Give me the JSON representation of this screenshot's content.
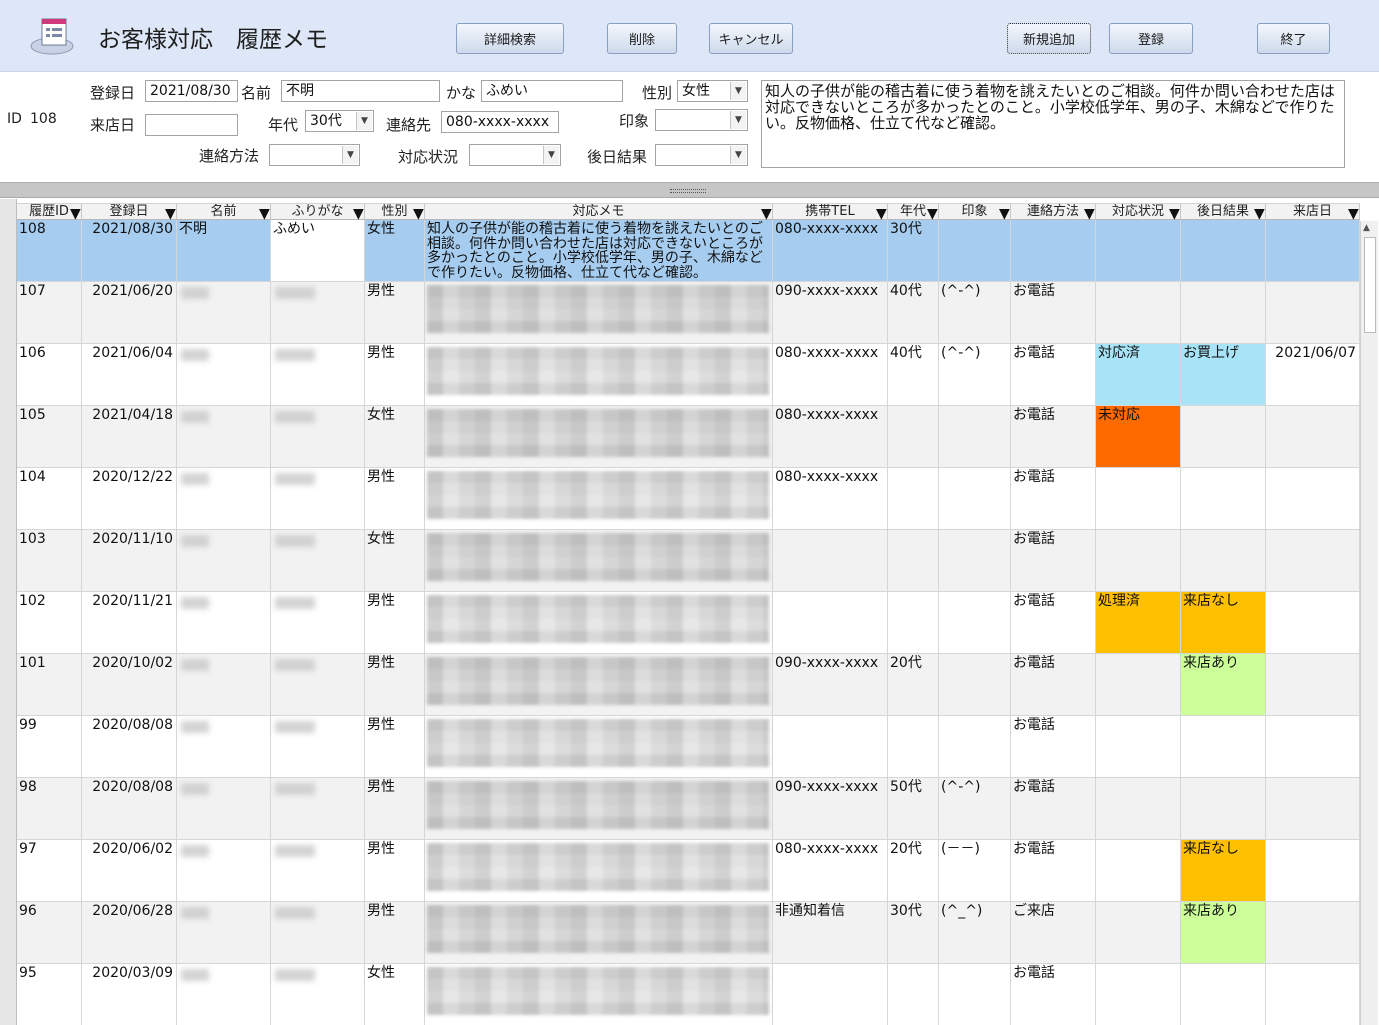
{
  "header": {
    "title": "お客様対応　履歴メモ",
    "buttons": {
      "detail_search": "詳細検索",
      "delete": "削除",
      "cancel": "キャンセル",
      "new_add": "新規追加",
      "register": "登録",
      "exit": "終了"
    }
  },
  "form": {
    "id_label": "ID",
    "id_value": "108",
    "reg_date_label": "登録日",
    "reg_date_value": "2021/08/30",
    "name_label": "名前",
    "name_value": "不明",
    "kana_label": "かな",
    "kana_value": "ふめい",
    "gender_label": "性別",
    "gender_value": "女性",
    "visit_date_label": "来店日",
    "visit_date_value": "",
    "age_label": "年代",
    "age_value": "30代",
    "contact_label": "連絡先",
    "contact_value": "080-xxxx-xxxx",
    "impression_label": "印象",
    "impression_value": "",
    "contact_method_label": "連絡方法",
    "contact_method_value": "",
    "status_label": "対応状況",
    "status_value": "",
    "result_label": "後日結果",
    "result_value": "",
    "memo": "知人の子供が能の稽古着に使う着物を誂えたいとのご相談。何件か問い合わせた店は対応できないところが多かったとのこと。小学校低学年、男の子、木綿などで作りたい。反物価格、仕立て代など確認。"
  },
  "columns": [
    "履歴ID",
    "登録日",
    "名前",
    "ふりがな",
    "性別",
    "対応メモ",
    "携帯TEL",
    "年代",
    "印象",
    "連絡方法",
    "対応状況",
    "後日結果",
    "来店日"
  ],
  "rows": [
    {
      "id": "108",
      "date": "2021/08/30",
      "name": "不明",
      "kana": "ふめい",
      "gender": "女性",
      "memo": "知人の子供が能の稽古着に使う着物を誂えたいとのご相談。何件か問い合わせた店は対応できないところが多かったとのこと。小学校低学年、男の子、木綿などで作りたい。反物価格、仕立て代など確認。",
      "tel": "080-xxxx-xxxx",
      "age": "30代",
      "impression": "",
      "method": "",
      "status": "",
      "result": "",
      "visit": ""
    },
    {
      "id": "107",
      "date": "2021/06/20",
      "name": "",
      "kana": "",
      "gender": "男性",
      "memo": "",
      "tel": "090-xxxx-xxxx",
      "age": "40代",
      "impression": "(^-^)",
      "method": "お電話",
      "status": "",
      "result": "",
      "visit": ""
    },
    {
      "id": "106",
      "date": "2021/06/04",
      "name": "",
      "kana": "",
      "gender": "男性",
      "memo": "",
      "tel": "080-xxxx-xxxx",
      "age": "40代",
      "impression": "(^-^)",
      "method": "お電話",
      "status": "対応済",
      "result": "お買上げ",
      "visit": "2021/06/07"
    },
    {
      "id": "105",
      "date": "2021/04/18",
      "name": "",
      "kana": "",
      "gender": "女性",
      "memo": "",
      "tel": "080-xxxx-xxxx",
      "age": "",
      "impression": "",
      "method": "お電話",
      "status": "未対応",
      "result": "",
      "visit": ""
    },
    {
      "id": "104",
      "date": "2020/12/22",
      "name": "",
      "kana": "",
      "gender": "男性",
      "memo": "",
      "tel": "080-xxxx-xxxx",
      "age": "",
      "impression": "",
      "method": "お電話",
      "status": "",
      "result": "",
      "visit": ""
    },
    {
      "id": "103",
      "date": "2020/11/10",
      "name": "",
      "kana": "",
      "gender": "女性",
      "memo": "",
      "tel": "",
      "age": "",
      "impression": "",
      "method": "お電話",
      "status": "",
      "result": "",
      "visit": ""
    },
    {
      "id": "102",
      "date": "2020/11/21",
      "name": "",
      "kana": "",
      "gender": "男性",
      "memo": "",
      "tel": "",
      "age": "",
      "impression": "",
      "method": "お電話",
      "status": "処理済",
      "result": "来店なし",
      "visit": ""
    },
    {
      "id": "101",
      "date": "2020/10/02",
      "name": "",
      "kana": "",
      "gender": "男性",
      "memo": "",
      "tel": "090-xxxx-xxxx",
      "age": "20代",
      "impression": "",
      "method": "お電話",
      "status": "",
      "result": "来店あり",
      "visit": ""
    },
    {
      "id": "99",
      "date": "2020/08/08",
      "name": "",
      "kana": "",
      "gender": "男性",
      "memo": "",
      "tel": "",
      "age": "",
      "impression": "",
      "method": "お電話",
      "status": "",
      "result": "",
      "visit": ""
    },
    {
      "id": "98",
      "date": "2020/08/08",
      "name": "",
      "kana": "",
      "gender": "男性",
      "memo": "",
      "tel": "090-xxxx-xxxx",
      "age": "50代",
      "impression": "(^-^)",
      "method": "お電話",
      "status": "",
      "result": "",
      "visit": ""
    },
    {
      "id": "97",
      "date": "2020/06/02",
      "name": "",
      "kana": "",
      "gender": "男性",
      "memo": "",
      "tel": "080-xxxx-xxxx",
      "age": "20代",
      "impression": "(－－)",
      "method": "お電話",
      "status": "",
      "result": "来店なし",
      "visit": ""
    },
    {
      "id": "96",
      "date": "2020/06/28",
      "name": "",
      "kana": "",
      "gender": "男性",
      "memo": "",
      "tel": "非通知着信",
      "age": "30代",
      "impression": "(^_^)",
      "method": "ご来店",
      "status": "",
      "result": "来店あり",
      "visit": ""
    },
    {
      "id": "95",
      "date": "2020/03/09",
      "name": "",
      "kana": "",
      "gender": "女性",
      "memo": "",
      "tel": "",
      "age": "",
      "impression": "",
      "method": "お電話",
      "status": "",
      "result": "",
      "visit": ""
    }
  ],
  "colors": {
    "header_bg": "#dde7f7",
    "selected_row": "#a6cdf0",
    "status_done_cyan": "#a8e4f8",
    "status_pending_orange": "#ff6a00",
    "status_processed_amber": "#ffc000",
    "result_visit_green": "#ccff99"
  }
}
